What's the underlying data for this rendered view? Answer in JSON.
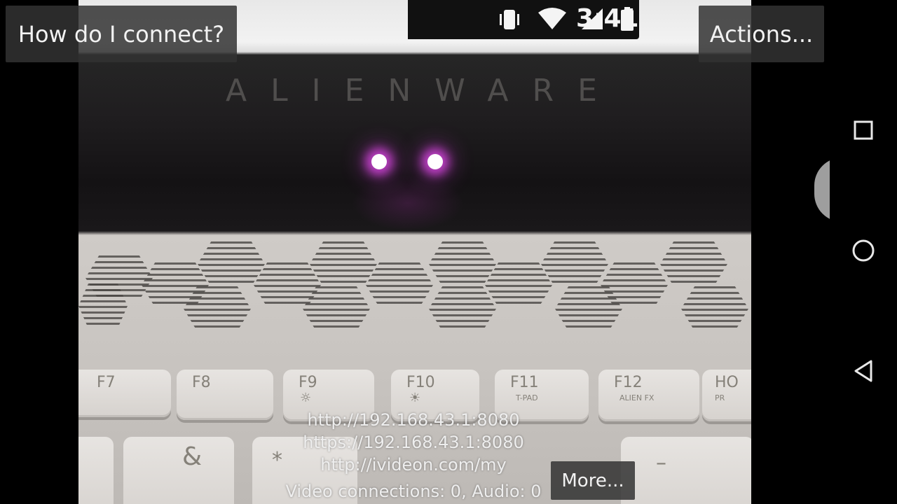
{
  "buttons": {
    "help": "How do I connect?",
    "actions": "Actions...",
    "more": "More..."
  },
  "preview": {
    "status_time": "3:41",
    "brand_text": "ALIENWARE",
    "keys": [
      {
        "label": "F7",
        "sub": ""
      },
      {
        "label": "F8",
        "sub": ""
      },
      {
        "label": "F9",
        "sub": ""
      },
      {
        "label": "F10",
        "sub": ""
      },
      {
        "label": "F11",
        "sub": "T-PAD"
      },
      {
        "label": "F12",
        "sub": "ALIEN FX"
      },
      {
        "label": "HO",
        "sub": "PR"
      }
    ],
    "lower_keys": [
      "",
      "&",
      "*",
      "",
      "",
      "",
      "–"
    ]
  },
  "info": {
    "url_http": "http://192.168.43.1:8080",
    "url_https": "https://192.168.43.1:8080",
    "ivideon": "http://ivideon.com/my",
    "connections": "Video connections: 0, Audio: 0"
  },
  "navbar": {
    "icons": [
      "recents-square-icon",
      "home-circle-icon",
      "back-triangle-icon"
    ]
  }
}
